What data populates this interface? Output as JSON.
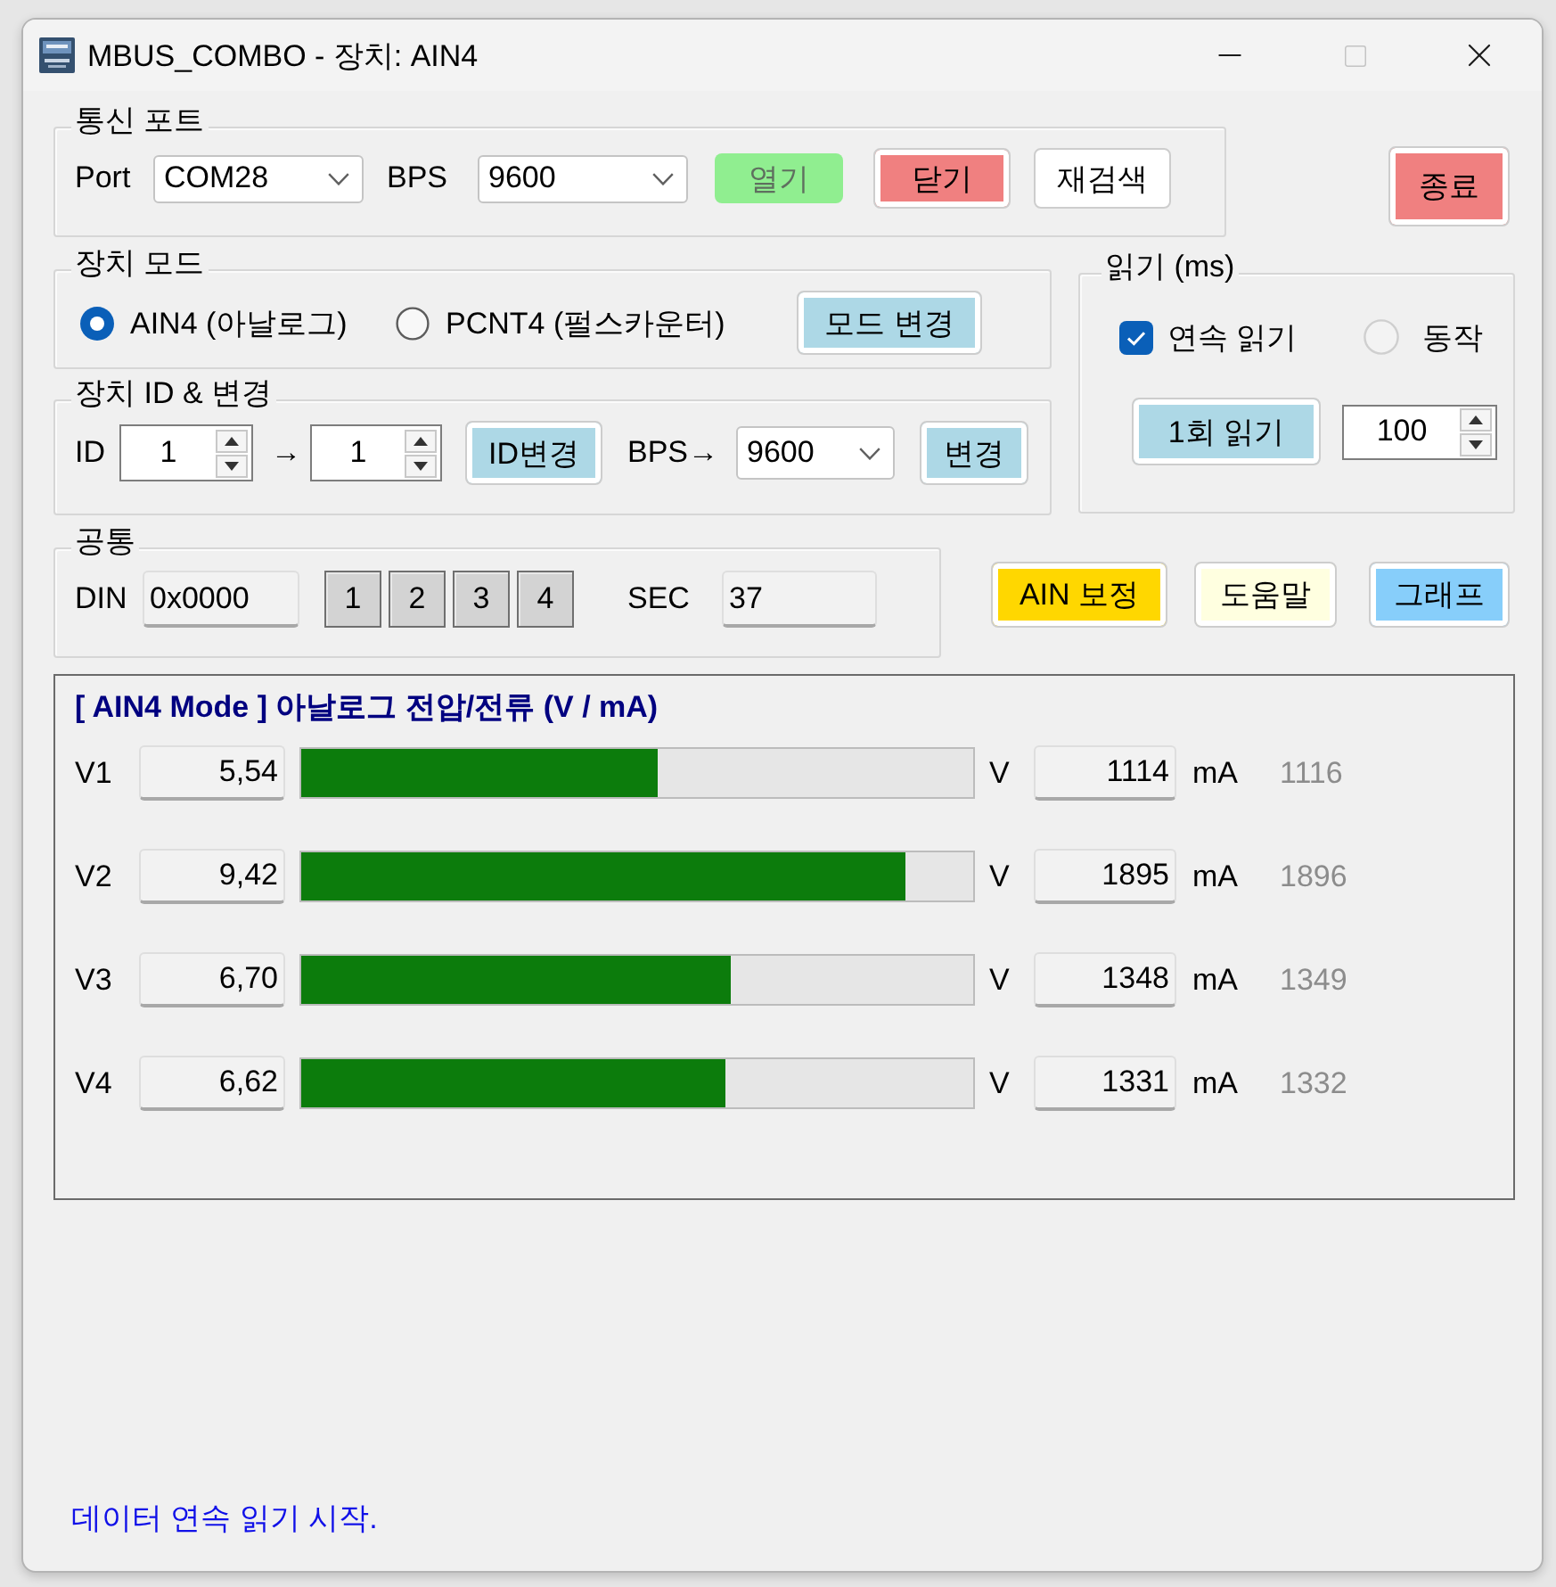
{
  "window": {
    "title": "MBUS_COMBO - 장치: AIN4",
    "maximize_disabled": true
  },
  "port_group": {
    "label": "통신 포트",
    "port_label": "Port",
    "port_value": "COM28",
    "bps_label": "BPS",
    "bps_value": "9600",
    "buttons": [
      {
        "label": "열기",
        "color": "#90ee90",
        "disabled": true
      },
      {
        "label": "닫기",
        "color": "#f08080",
        "disabled": false
      },
      {
        "label": "재검색",
        "color": "#ffffff",
        "disabled": false
      }
    ]
  },
  "exit_button": {
    "label": "종료",
    "color": "#f08080"
  },
  "mode_group": {
    "label": "장치 모드",
    "options": [
      {
        "label": "AIN4 (아날로그)",
        "selected": true
      },
      {
        "label": "PCNT4 (펄스카운터)",
        "selected": false
      }
    ],
    "button": {
      "label": "모드 변경",
      "color": "#add8e6"
    }
  },
  "id_group": {
    "label": "장치 ID & 변경",
    "id_label": "ID",
    "id_value": "1",
    "arrow": "→",
    "new_id_value": "1",
    "id_button": {
      "label": "ID변경",
      "color": "#add8e6"
    },
    "bps_label": "BPS→",
    "bps_value": "9600",
    "bps_button": {
      "label": "변경",
      "color": "#add8e6"
    }
  },
  "read_group": {
    "label": "읽기 (ms)",
    "continuous": {
      "label": "연속 읽기",
      "checked": true
    },
    "activity": {
      "label": "동작",
      "on": false
    },
    "once_button": {
      "label": "1회 읽기",
      "color": "#add8e6"
    },
    "interval_value": "100"
  },
  "common_group": {
    "label": "공통",
    "din_label": "DIN",
    "din_value": "0x0000",
    "inputs": [
      {
        "label": "1",
        "on": false
      },
      {
        "label": "2",
        "on": false
      },
      {
        "label": "3",
        "on": false
      },
      {
        "label": "4",
        "on": false
      }
    ],
    "sec_label": "SEC",
    "sec_value": "37"
  },
  "action_buttons": [
    {
      "label": "AIN 보정",
      "color": "#ffd700"
    },
    {
      "label": "도움말",
      "color": "#ffffe0"
    },
    {
      "label": "그래프",
      "color": "#87cefa"
    }
  ],
  "channels_panel": {
    "title": "[ AIN4 Mode ] 아날로그 전압/전류 (V / mA)",
    "channels": [
      {
        "name": "V1",
        "voltage": "5,54",
        "level": 0.53,
        "voltage_unit": "V",
        "current": "1114",
        "current_unit": "mA",
        "raw": "1116"
      },
      {
        "name": "V2",
        "voltage": "9,42",
        "level": 0.9,
        "voltage_unit": "V",
        "current": "1895",
        "current_unit": "mA",
        "raw": "1896"
      },
      {
        "name": "V3",
        "voltage": "6,70",
        "level": 0.64,
        "voltage_unit": "V",
        "current": "1348",
        "current_unit": "mA",
        "raw": "1349"
      },
      {
        "name": "V4",
        "voltage": "6,62",
        "level": 0.63,
        "voltage_unit": "V",
        "current": "1331",
        "current_unit": "mA",
        "raw": "1332"
      }
    ]
  },
  "status_bar": {
    "text": "데이터 연속 읽기 시작."
  }
}
